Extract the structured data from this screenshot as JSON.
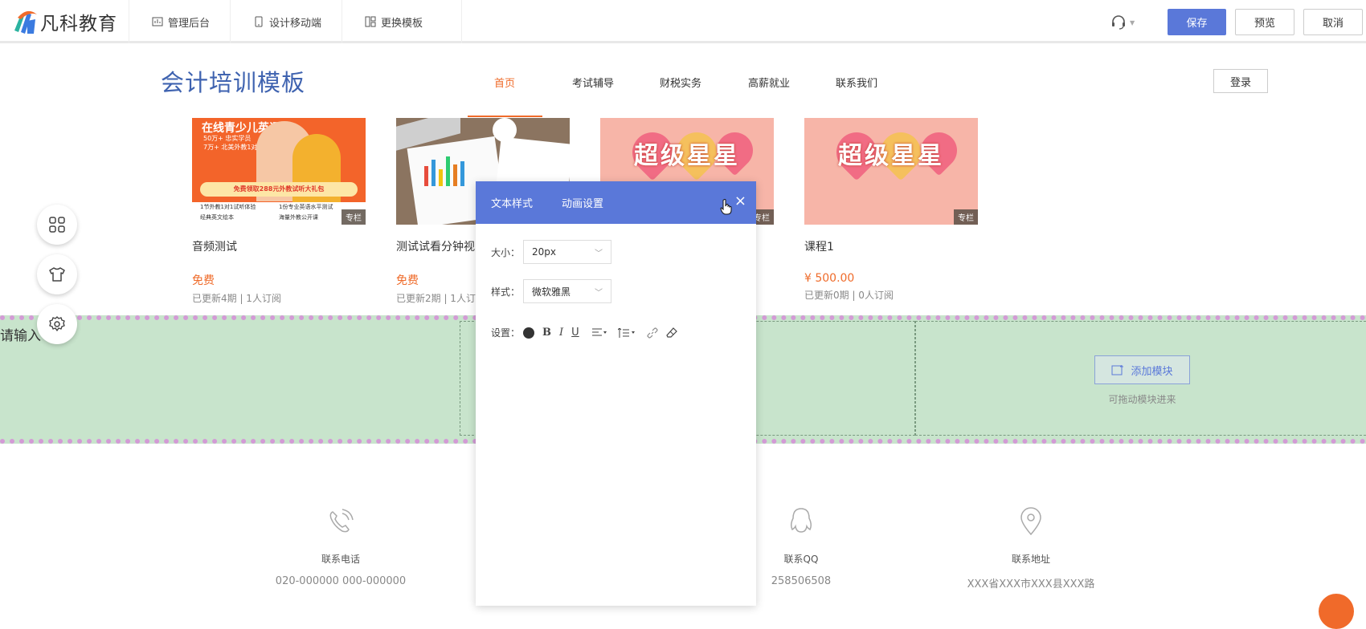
{
  "topbar": {
    "brand": "凡科教育",
    "nav": [
      {
        "label": "管理后台",
        "icon": "chart-icon"
      },
      {
        "label": "设计移动端",
        "icon": "mobile-icon"
      },
      {
        "label": "更换模板",
        "icon": "template-icon"
      }
    ],
    "save": "保存",
    "preview": "预览",
    "cancel": "取消"
  },
  "site": {
    "title": "会计培训模板",
    "nav": [
      "首页",
      "考试辅导",
      "财税实务",
      "高薪就业",
      "联系我们"
    ],
    "active_nav": "首页",
    "login": "登录"
  },
  "courses": [
    {
      "title": "音频测试",
      "price": "免费",
      "meta": "已更新4期 | 1人订阅",
      "tag": "专栏",
      "banner": "在线青少儿英语",
      "banner_lines": [
        "50万+ 忠实学员",
        "7万+ 北美外教1对1授课"
      ],
      "promo": "免费领取288元外教试听大礼包",
      "bullets": [
        "1节外教1对1试听体验",
        "1份专业英语水平测试",
        "经典英文绘本",
        "海量外教公开课"
      ]
    },
    {
      "title": "测试试看分钟视",
      "price": "免费",
      "meta": "已更新2期 | 1人订",
      "tag": "专栏"
    },
    {
      "title": "",
      "price": "",
      "meta": "",
      "tag": "专栏",
      "banner": "超级星星"
    },
    {
      "title": "课程1",
      "price": "¥ 500.00",
      "meta": "已更新0期 | 0人订阅",
      "tag": "专栏",
      "banner": "超级星星"
    }
  ],
  "green_section": {
    "input_placeholder": "请输入",
    "add_module": "添加模块",
    "add_hint": "可拖动模块进来"
  },
  "floaters": [
    "grid-icon",
    "shirt-icon",
    "settings-icon"
  ],
  "contacts": [
    {
      "label": "联系电话",
      "value": "020-000000 000-000000",
      "icon": "phone-icon"
    },
    {
      "label": "联系QQ",
      "value": "258506508",
      "icon": "qq-icon"
    },
    {
      "label": "联系地址",
      "value": "XXX省XXX市XXX县XXX路",
      "icon": "location-icon"
    }
  ],
  "panel": {
    "tabs": [
      "文本样式",
      "动画设置"
    ],
    "size_label": "大小：",
    "size_value": "20px",
    "style_label": "样式：",
    "style_value": "微软雅黑",
    "settings_label": "设置："
  },
  "colors": {
    "accent": "#5a78d9",
    "orange": "#ef6b2a",
    "title_blue": "#3f63b0",
    "green_bg": "#c8e4cc"
  }
}
